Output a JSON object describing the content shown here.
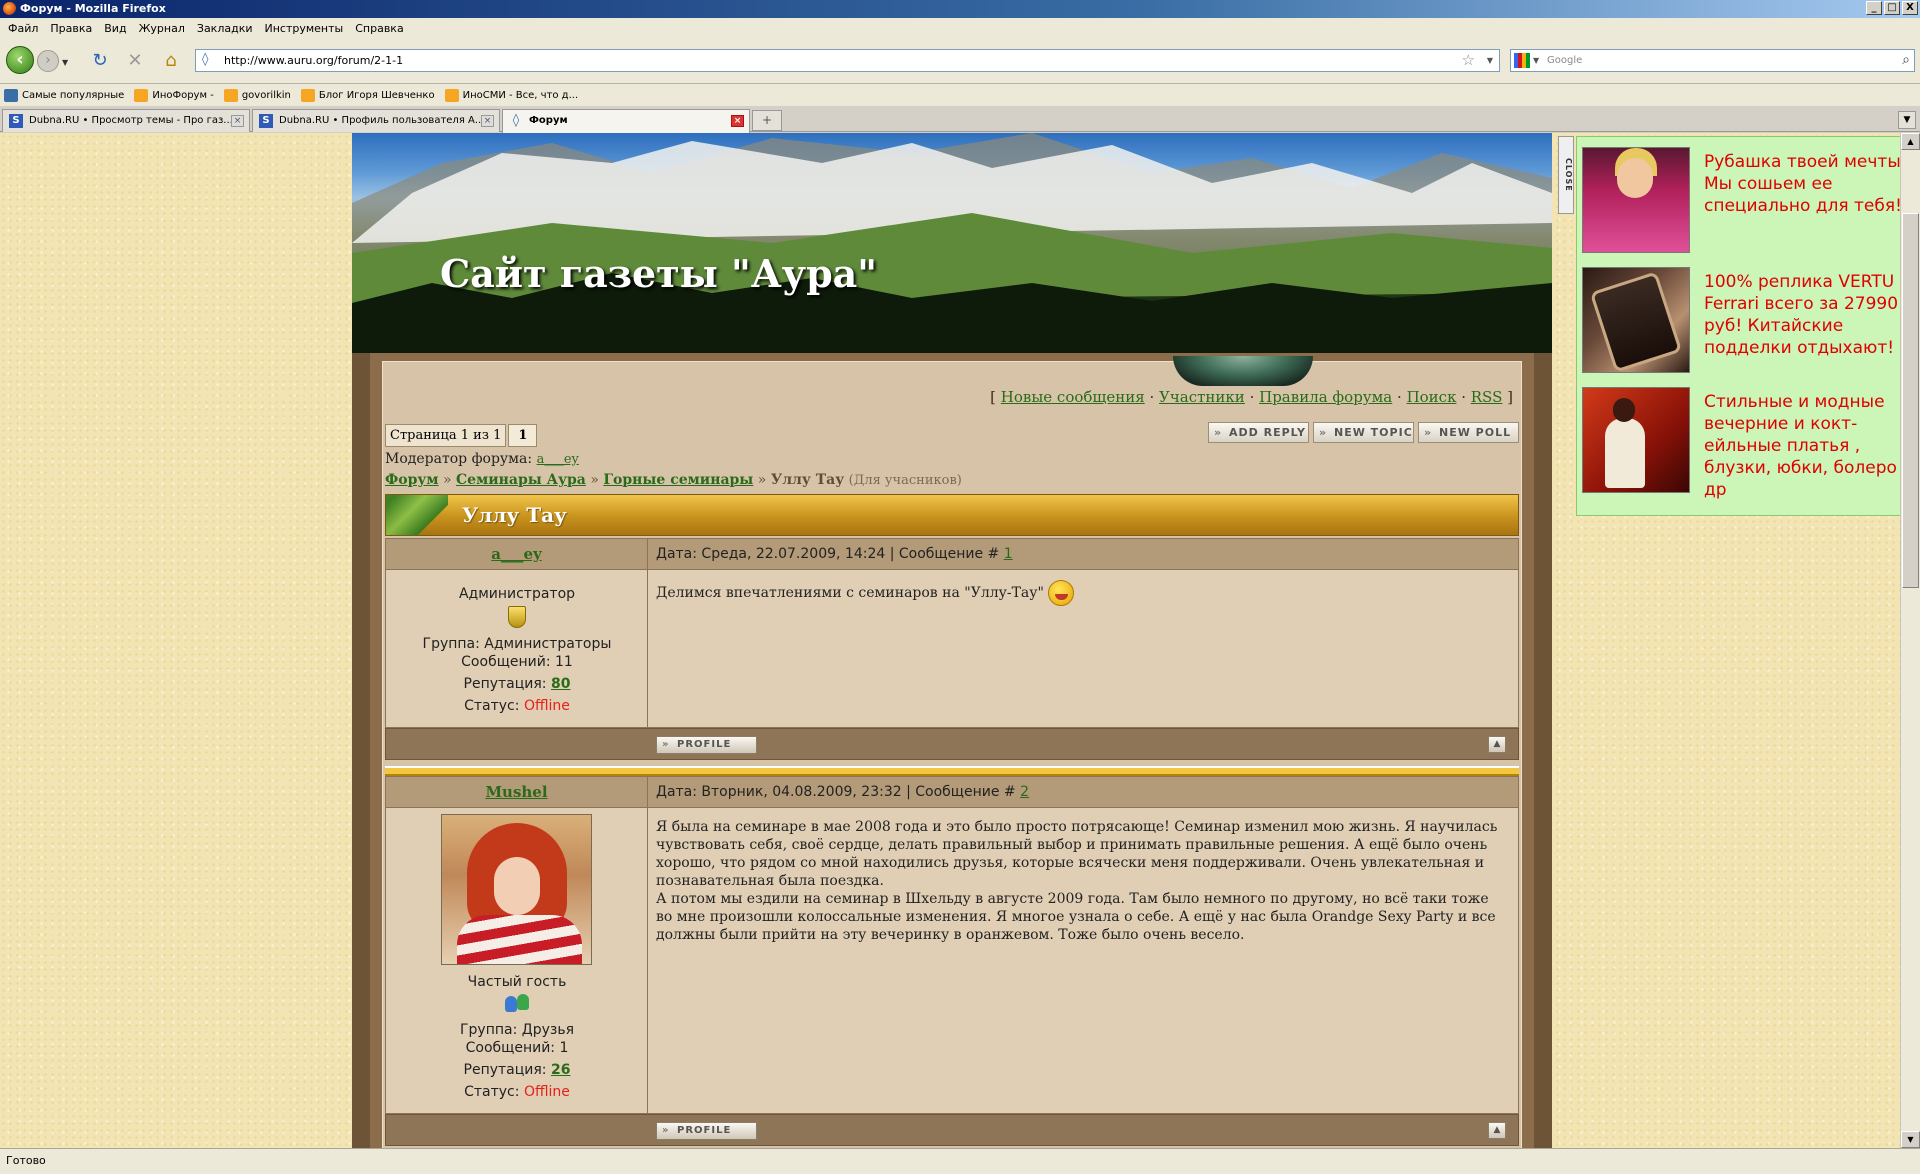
{
  "window": {
    "title": "Форум - Mozilla Firefox",
    "buttons": {
      "minimize": "_",
      "maximize": "□",
      "close": "X"
    }
  },
  "menu": [
    "Файл",
    "Правка",
    "Вид",
    "Журнал",
    "Закладки",
    "Инструменты",
    "Справка"
  ],
  "nav": {
    "url": "http://www.auru.org/forum/2-1-1",
    "search_placeholder": "Google"
  },
  "bookmarks": [
    {
      "label": "Самые популярные",
      "icon": "star-icon"
    },
    {
      "label": "ИноФорум -",
      "icon": "rss-icon"
    },
    {
      "label": "govorilkin",
      "icon": "rss-icon"
    },
    {
      "label": "Блог Игоря Шевченко",
      "icon": "rss-icon"
    },
    {
      "label": "ИноСМИ - Все, что д...",
      "icon": "rss-icon"
    }
  ],
  "tabs": [
    {
      "label": "Dubna.RU • Просмотр темы - Про газ...",
      "icon": "dubna-icon"
    },
    {
      "label": "Dubna.RU • Профиль пользователя А...",
      "icon": "dubna-icon"
    },
    {
      "label": "Форум",
      "icon": "globe-icon",
      "active": true
    }
  ],
  "status": "Готово",
  "site": {
    "title": "Сайт газеты \"Аура\""
  },
  "forum": {
    "top_links": {
      "open": "[",
      "items": [
        "Новые сообщения",
        "Участники",
        "Правила форума",
        "Поиск",
        "RSS"
      ],
      "close": "]"
    },
    "pager": {
      "label": "Страница 1 из 1",
      "current": "1"
    },
    "action_buttons": [
      "Add Reply",
      "New Topic",
      "New Poll"
    ],
    "moderator": {
      "label": "Модератор форума:",
      "name": "a___ey"
    },
    "breadcrumbs": [
      "Форум",
      "Семинары Аура",
      "Горные семинары"
    ],
    "breadcrumb_sep": "»",
    "current_topic": "Уллу Тау",
    "topic_note": "(Для учасников)",
    "topic_title": "Уллу Тау",
    "posts": [
      {
        "author": "a___ey",
        "meta_prefix": "Дата: Среда, 22.07.2009, 14:24 | Сообщение #",
        "number": "1",
        "rank": "Администратор",
        "group": "Группа: Администраторы",
        "messages": "Сообщений: 11",
        "reputation_label": "Репутация:",
        "reputation": "80",
        "status_label": "Статус:",
        "status": "Offline",
        "text": "Делимся впечатлениями с семинаров на \"Уллу-Тау\""
      },
      {
        "author": "Mushel",
        "meta_prefix": "Дата: Вторник, 04.08.2009, 23:32 | Сообщение #",
        "number": "2",
        "rank": "Частый гость",
        "group": "Группа: Друзья",
        "messages": "Сообщений: 1",
        "reputation_label": "Репутация:",
        "reputation": "26",
        "status_label": "Статус:",
        "status": "Offline",
        "text": "Я была на семинаре в мае 2008 года и это было просто потрясающе! Семинар изменил мою жизнь. Я научилась чувствовать себя, своё сердце, делать правильный выбор и принимать правильные решения. А ещё было очень хорошо, что рядом со мной находились друзья, которые всячески меня поддерживали. Очень увлекательная и познавательная была поездка.",
        "text2": "А потом мы ездили на семинар в Шхельду в августе 2009 года. Там было немного по другому, но всё таки тоже во мне произошли колоссальные изменения. Я многое узнала о себе. А ещё у нас была Orandge Sexy Party и все должны были прийти на эту вечеринку в оранжевом. Тоже было очень весело."
      }
    ],
    "profile_button": "Profile"
  },
  "ads": {
    "close_label": "CLOSE",
    "items": [
      {
        "text": "Рубашка твоей мечты! Мы сошьем ее специально для тебя!"
      },
      {
        "text": "100% реплика VERTU Ferrari всего за 27990 руб! Китайские подделки отдыхают!"
      },
      {
        "text": "Стильные и модные вечерние и кокт-ейльные платья , блузки, юбки, болеро и др"
      }
    ]
  }
}
